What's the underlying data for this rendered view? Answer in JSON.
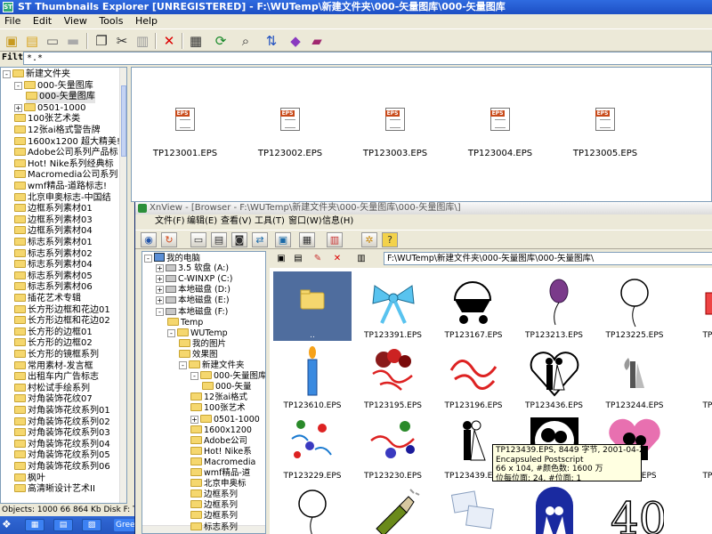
{
  "window": {
    "title": "ST Thumbnails Explorer [UNREGISTERED] - F:\\WUTemp\\新建文件夹\\000-矢量图库\\000-矢量图库",
    "app_icon": "ST"
  },
  "menu": [
    "File",
    "Edit",
    "View",
    "Tools",
    "Help"
  ],
  "toolbar_icons": [
    "up-folder-icon",
    "new-folder-icon",
    "map-drive-icon",
    "disconnect-icon",
    "copy-icon",
    "cut-icon",
    "paste-icon",
    "delete-icon",
    "properties-icon",
    "refresh-icon",
    "find-icon",
    "sort-icon",
    "slideshow-icon",
    "help-book-icon"
  ],
  "filter": {
    "label": "Filt",
    "value": "*.*"
  },
  "left_tree": [
    {
      "label": "新建文件夹",
      "indent": 0,
      "expander": "-"
    },
    {
      "label": "000-矢量图库",
      "indent": 1,
      "expander": "-"
    },
    {
      "label": "000-矢量图库",
      "indent": 2,
      "expander": "",
      "selected": true
    },
    {
      "label": "0501-1000",
      "indent": 1,
      "expander": "+"
    },
    {
      "label": "100张艺术类",
      "indent": 1,
      "expander": ""
    },
    {
      "label": "12张ai格式警告牌",
      "indent": 1,
      "expander": ""
    },
    {
      "label": "1600x1200 超大精美!",
      "indent": 1,
      "expander": ""
    },
    {
      "label": "Adobe公司系列产品标",
      "indent": 1,
      "expander": ""
    },
    {
      "label": "Hot! Nike系列经典标",
      "indent": 1,
      "expander": ""
    },
    {
      "label": "Macromedia公司系列",
      "indent": 1,
      "expander": ""
    },
    {
      "label": "wmf精品-道路标志!",
      "indent": 1,
      "expander": ""
    },
    {
      "label": "北京申奥标志-中国结",
      "indent": 1,
      "expander": ""
    },
    {
      "label": "边框系列素材01",
      "indent": 1,
      "expander": ""
    },
    {
      "label": "边框系列素材03",
      "indent": 1,
      "expander": ""
    },
    {
      "label": "边框系列素材04",
      "indent": 1,
      "expander": ""
    },
    {
      "label": "标志系列素材01",
      "indent": 1,
      "expander": ""
    },
    {
      "label": "标志系列素材02",
      "indent": 1,
      "expander": ""
    },
    {
      "label": "标志系列素材04",
      "indent": 1,
      "expander": ""
    },
    {
      "label": "标志系列素材05",
      "indent": 1,
      "expander": ""
    },
    {
      "label": "标志系列素材06",
      "indent": 1,
      "expander": ""
    },
    {
      "label": "插花艺术专辑",
      "indent": 1,
      "expander": ""
    },
    {
      "label": "长方形边框和花边01",
      "indent": 1,
      "expander": ""
    },
    {
      "label": "长方形边框和花边02",
      "indent": 1,
      "expander": ""
    },
    {
      "label": "长方形的边框01",
      "indent": 1,
      "expander": ""
    },
    {
      "label": "长方形的边框02",
      "indent": 1,
      "expander": ""
    },
    {
      "label": "长方形的镜框系列",
      "indent": 1,
      "expander": ""
    },
    {
      "label": "常用素材-发言框",
      "indent": 1,
      "expander": ""
    },
    {
      "label": "出租车内广告标志",
      "indent": 1,
      "expander": ""
    },
    {
      "label": "村松试手绘系列",
      "indent": 1,
      "expander": ""
    },
    {
      "label": "对角装饰花纹07",
      "indent": 1,
      "expander": ""
    },
    {
      "label": "对角装饰花纹系列01",
      "indent": 1,
      "expander": ""
    },
    {
      "label": "对角装饰花纹系列02",
      "indent": 1,
      "expander": ""
    },
    {
      "label": "对角装饰花纹系列03",
      "indent": 1,
      "expander": ""
    },
    {
      "label": "对角装饰花纹系列04",
      "indent": 1,
      "expander": ""
    },
    {
      "label": "对角装饰花纹系列05",
      "indent": 1,
      "expander": ""
    },
    {
      "label": "对角装饰花纹系列06",
      "indent": 1,
      "expander": ""
    },
    {
      "label": "枫叶",
      "indent": 1,
      "expander": ""
    },
    {
      "label": "高清晰设计艺术II",
      "indent": 1,
      "expander": ""
    }
  ],
  "status": {
    "text": "Objects: 1000   66 864 Kb   Disk F: Total"
  },
  "taskbar": {
    "green_label": "Green"
  },
  "eps_files": [
    "TP123001.EPS",
    "TP123002.EPS",
    "TP123003.EPS",
    "TP123004.EPS",
    "TP123005.EPS"
  ],
  "xnview": {
    "title": "XnView - [Browser - F:\\WUTemp\\新建文件夹\\000-矢量图库\\000-矢量图库\\]",
    "menu": [
      "文件(F)",
      "编辑(E)",
      "查看(V)",
      "工具(T)",
      "窗口(W)",
      "信息(H)"
    ],
    "path": "F:\\WUTemp\\新建文件夹\\000-矢量图库\\000-矢量图库\\",
    "tree": [
      {
        "label": "我的电脑",
        "indent": 0,
        "expander": "-",
        "kind": "pc"
      },
      {
        "label": "3.5 软盘 (A:)",
        "indent": 1,
        "expander": "+",
        "kind": "drive"
      },
      {
        "label": "C-WINXP (C:)",
        "indent": 1,
        "expander": "+",
        "kind": "drive"
      },
      {
        "label": "本地磁盘 (D:)",
        "indent": 1,
        "expander": "+",
        "kind": "drive"
      },
      {
        "label": "本地磁盘 (E:)",
        "indent": 1,
        "expander": "+",
        "kind": "drive"
      },
      {
        "label": "本地磁盘 (F:)",
        "indent": 1,
        "expander": "-",
        "kind": "drive"
      },
      {
        "label": "Temp",
        "indent": 2,
        "expander": "",
        "kind": "folder"
      },
      {
        "label": "WUTemp",
        "indent": 2,
        "expander": "-",
        "kind": "folder"
      },
      {
        "label": "我的图片",
        "indent": 3,
        "expander": "",
        "kind": "folder"
      },
      {
        "label": "效果图",
        "indent": 3,
        "expander": "",
        "kind": "folder"
      },
      {
        "label": "新建文件夹",
        "indent": 3,
        "expander": "-",
        "kind": "folder"
      },
      {
        "label": "000-矢量图库",
        "indent": 4,
        "expander": "-",
        "kind": "folder"
      },
      {
        "label": "000-矢量",
        "indent": 5,
        "expander": "",
        "kind": "folder"
      },
      {
        "label": "12张ai格式",
        "indent": 4,
        "expander": "",
        "kind": "folder"
      },
      {
        "label": "100张艺术",
        "indent": 4,
        "expander": "",
        "kind": "folder"
      },
      {
        "label": "0501-1000",
        "indent": 4,
        "expander": "+",
        "kind": "folder"
      },
      {
        "label": "1600x1200",
        "indent": 4,
        "expander": "",
        "kind": "folder"
      },
      {
        "label": "Adobe公司",
        "indent": 4,
        "expander": "",
        "kind": "folder"
      },
      {
        "label": "Hot! Nike系",
        "indent": 4,
        "expander": "",
        "kind": "folder"
      },
      {
        "label": "Macromedia",
        "indent": 4,
        "expander": "",
        "kind": "folder"
      },
      {
        "label": "wmf精品-道",
        "indent": 4,
        "expander": "",
        "kind": "folder"
      },
      {
        "label": "北京申奥标",
        "indent": 4,
        "expander": "",
        "kind": "folder"
      },
      {
        "label": "边框系列",
        "indent": 4,
        "expander": "",
        "kind": "folder"
      },
      {
        "label": "边框系列",
        "indent": 4,
        "expander": "",
        "kind": "folder"
      },
      {
        "label": "边框系列",
        "indent": 4,
        "expander": "",
        "kind": "folder"
      },
      {
        "label": "标志系列",
        "indent": 4,
        "expander": "",
        "kind": "folder"
      }
    ],
    "thumbnails": [
      {
        "label": "..",
        "icon": "parent-folder-icon",
        "selected": true
      },
      {
        "label": "TP123391.EPS",
        "icon": "bow-ribbon-icon"
      },
      {
        "label": "TP123167.EPS",
        "icon": "baby-carriage-icon"
      },
      {
        "label": "TP123213.EPS",
        "icon": "balloon-icon"
      },
      {
        "label": "TP123225.EPS",
        "icon": "balloon-outline-icon"
      },
      {
        "label": "TP12..",
        "icon": "gift-box-icon"
      },
      {
        "label": "TP123610.EPS",
        "icon": "birthday-candle-icon"
      },
      {
        "label": "TP123195.EPS",
        "icon": "balloons-ribbons-icon"
      },
      {
        "label": "TP123196.EPS",
        "icon": "ribbons-icon"
      },
      {
        "label": "TP123436.EPS",
        "icon": "wedding-couple-heart-icon"
      },
      {
        "label": "TP123244.EPS",
        "icon": "wedding-figures-icon"
      },
      {
        "label": "TP12..",
        "icon": "partial-icon"
      },
      {
        "label": "TP123229.EPS",
        "icon": "confetti-icon"
      },
      {
        "label": "TP123230.EPS",
        "icon": "confetti-balls-icon"
      },
      {
        "label": "TP123439.EPS",
        "icon": "bride-groom-icon"
      },
      {
        "label": "",
        "icon": "couple-silhouette-icon"
      },
      {
        "label": "TP...49.EPS",
        "icon": "couple-heart-icon"
      },
      {
        "label": "TP12..",
        "icon": "partial-icon"
      },
      {
        "label": "",
        "icon": "balloon-outline-icon"
      },
      {
        "label": "",
        "icon": "champagne-bottle-icon"
      },
      {
        "label": "",
        "icon": "photo-cards-icon"
      },
      {
        "label": "",
        "icon": "wedding-arch-icon"
      },
      {
        "label": "",
        "icon": "number-forty-icon"
      },
      {
        "label": "",
        "icon": "partial-icon"
      }
    ],
    "tooltip": [
      "TP123439.EPS, 8449 字节, 2001-04-24 15:11",
      "Encapsuled Postscript",
      "66 x 104, #颜色数: 1600 万",
      "位每位面: 24, #位面: 1"
    ]
  }
}
